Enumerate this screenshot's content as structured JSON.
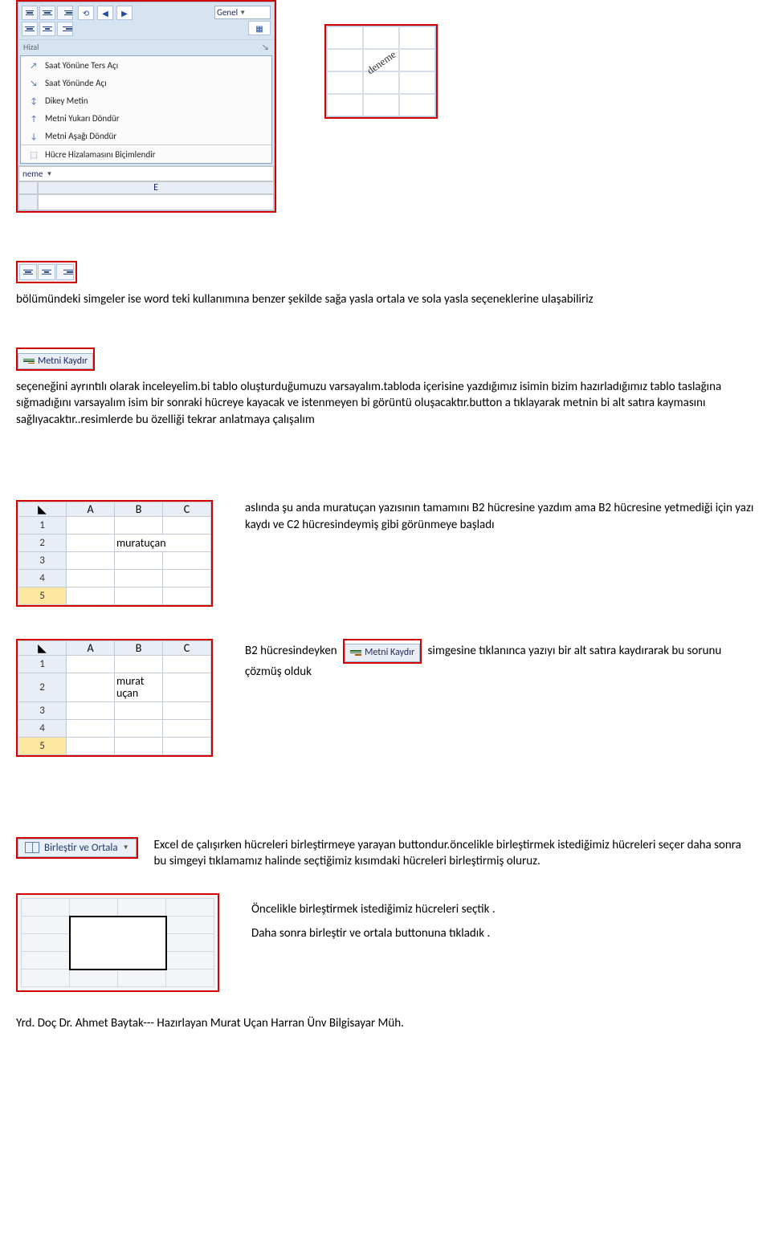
{
  "ribbon": {
    "number_group": "Genel",
    "section": "Hizal",
    "name_box": "neme",
    "col_letter": "E",
    "menu": {
      "ccw": "Saat Yönüne Ters Açı",
      "cw": "Saat Yönünde Açı",
      "vert": "Dikey Metin",
      "up": "Metni Yukarı Döndür",
      "down": "Metni Aşağı Döndür",
      "format": "Hücre Hizalamasını Biçimlendir"
    }
  },
  "preview": {
    "diag": "deneme"
  },
  "para1": "bölümündeki simgeler ise word teki kullanımına benzer şekilde sağa yasla ortala ve sola yasla seçeneklerine ulaşabiliriz",
  "wrap_label": "Metni Kaydır",
  "para2": "seçeneğini ayrıntılı olarak inceleyelim.bi tablo oluşturduğumuzu varsayalım.tabloda içerisine yazdığımız isimin bizim hazırladığımız tablo taslağına sığmadığını varsayalım isim bir sonraki hücreye kayacak ve istenmeyen bi görüntü oluşacaktır.button a tıklayarak metnin bi alt satıra kaymasını sağlıyacaktır..resimlerde bu özelliği tekrar anlatmaya çalışalım",
  "table1": {
    "cols": [
      "A",
      "B",
      "C"
    ],
    "rows": [
      "1",
      "2",
      "3",
      "4",
      "5"
    ],
    "b2": "muratuçan"
  },
  "desc1": "aslında şu anda muratuçan yazısının tamamını B2 hücresine yazdım ama B2 hücresine yetmediği için yazı kaydı ve C2 hücresindeymiş gibi görünmeye başladı",
  "table2": {
    "cols": [
      "A",
      "B",
      "C"
    ],
    "rows": [
      "1",
      "2",
      "3",
      "4",
      "5"
    ],
    "b2a": "murat",
    "b2b": "uçan"
  },
  "desc2a": "B2 hücresindeyken",
  "desc2b": "simgesine tıklanınca yazıyı bir alt satıra kaydırarak bu sorunu çözmüş olduk",
  "merge_label": "Birleştir ve Ortala",
  "para3a": "Excel de çalışırken hücreleri birleştirmeye yarayan buttondur.öncelikle birleştirmek istediğimiz hücreleri seçer daha sonra bu simgeyi tıklamamız halinde seçtiğimiz kısımdaki hücreleri birleştirmiş oluruz.",
  "para3b": "Öncelikle  birleştirmek istediğimiz hücreleri seçtik .",
  "para3c": "Daha sonra birleştir ve ortala buttonuna tıkladık .",
  "footer": "Yrd. Doç Dr. Ahmet Baytak--- Hazırlayan Murat Uçan Harran Ünv Bilgisayar Müh."
}
